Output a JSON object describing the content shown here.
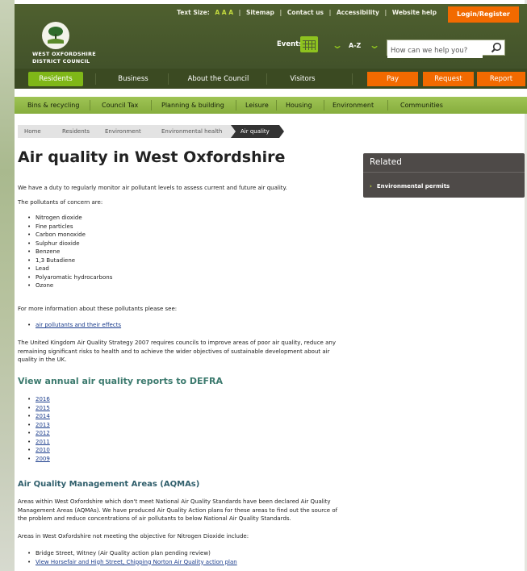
{
  "header": {
    "text_size_label": "Text Size:",
    "text_size_options": "A A A",
    "sitemap": "Sitemap",
    "contact": "Contact us",
    "accessibility": "Accessibility",
    "website_help": "Website help",
    "login": "Login/Register",
    "logo_line1": "WEST OXFORDSHIRE",
    "logo_line2": "DISTRICT COUNCIL",
    "events": "Events",
    "az": "A-Z",
    "search_placeholder": "How can we help you?"
  },
  "main_nav": {
    "residents": "Residents",
    "business": "Business",
    "about": "About the Council",
    "visitors": "Visitors",
    "pay": "Pay",
    "request": "Request",
    "report": "Report"
  },
  "sub_nav": [
    "Bins & recycling",
    "Council Tax",
    "Planning & building",
    "Leisure",
    "Housing",
    "Environment",
    "Communities"
  ],
  "breadcrumb": [
    "Home",
    "Residents",
    "Environment",
    "Environmental health",
    "Air quality"
  ],
  "page": {
    "title": "Air quality in West Oxfordshire",
    "intro": "We have a duty to regularly monitor air pollutant levels to assess current and future air quality.",
    "pollutants_intro": "The pollutants of concern are:",
    "pollutants": [
      "Nitrogen dioxide",
      "Fine particles",
      "Carbon monoxide",
      "Sulphur dioxide",
      "Benzene",
      "1,3 Butadiene",
      "Lead",
      "Polyaromatic hydrocarbons",
      "Ozone"
    ],
    "more_info": "For more information about these pollutants please see:",
    "more_info_link": "air pollutants and their effects",
    "strategy_line1": "The United Kingdom Air Quality Strategy 2007 requires councils to improve areas of poor air quality, reduce any",
    "strategy_line2": "remaining significant risks to health and to achieve the wider objectives of sustainable development about air",
    "strategy_line3": "quality in the UK.",
    "reports_heading": "View annual air quality reports to DEFRA",
    "report_years": [
      "2016",
      "2015",
      "2014",
      "2013",
      "2012",
      "2011",
      "2010",
      "2009"
    ],
    "aqma_heading": "Air Quality Management Areas (AQMAs)",
    "aqma_line1": "Areas within West Oxfordshire which don't meet National Air Quality Standards have been declared Air Quality",
    "aqma_line2": "Management Areas (AQMAs). We have produced Air Quality Action plans for these areas to find out the source of",
    "aqma_line3": "the problem and reduce concentrations of air pollutants to below National Air Quality Standards.",
    "no2_intro": "Areas in West Oxfordshire not meeting the objective for Nitrogen Dioxide include:",
    "no2_item1": "Bridge Street, Witney (Air Quality action plan pending review)",
    "no2_item2": "View Horsefair and High Street, Chipping Norton Air Quality action plan"
  },
  "related": {
    "title": "Related",
    "link": "Environmental permits"
  },
  "colors": {
    "header_green": "#4a5a2a",
    "nav_dark": "#3b4a22",
    "residents_green": "#7fb718",
    "orange": "#f26a00",
    "subnav_green": "#93ba4a",
    "related_bg": "#4e4a48"
  }
}
